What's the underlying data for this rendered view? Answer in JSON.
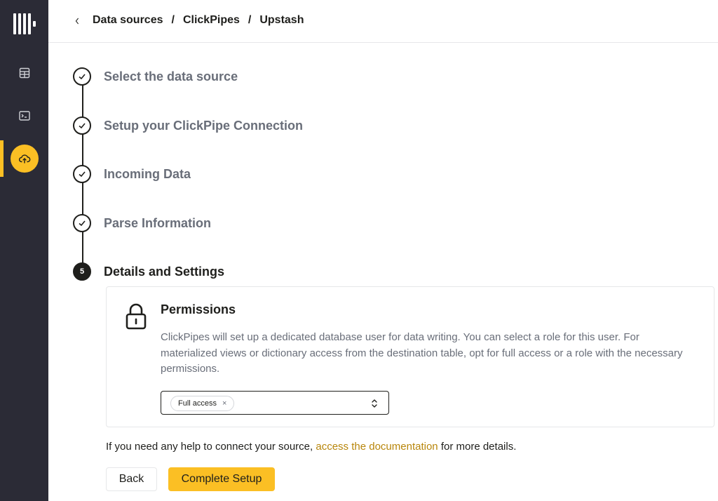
{
  "breadcrumb": {
    "items": [
      "Data sources",
      "ClickPipes",
      "Upstash"
    ],
    "separator": "/"
  },
  "sidebar": {
    "items": [
      {
        "icon": "table-icon"
      },
      {
        "icon": "terminal-icon"
      },
      {
        "icon": "cloud-upload-icon",
        "active": true
      }
    ]
  },
  "steps": [
    {
      "label": "Select the data source",
      "status": "complete"
    },
    {
      "label": "Setup your ClickPipe Connection",
      "status": "complete"
    },
    {
      "label": "Incoming Data",
      "status": "complete"
    },
    {
      "label": "Parse Information",
      "status": "complete"
    },
    {
      "number": "5",
      "label": "Details and Settings",
      "status": "current"
    }
  ],
  "permissions": {
    "title": "Permissions",
    "description": "ClickPipes will set up a dedicated database user for data writing. You can select a role for this user. For materialized views or dictionary access from the destination table, opt for full access or a role with the necessary permissions.",
    "selected_role": "Full access",
    "chip_remove": "×"
  },
  "help": {
    "prefix": "If you need any help to connect your source,",
    "link_text": "access the documentation",
    "suffix": "for more details."
  },
  "buttons": {
    "back": "Back",
    "complete": "Complete Setup"
  },
  "colors": {
    "sidebar_bg": "#2b2b36",
    "accent": "#fbbf24",
    "link": "#b8860b",
    "text_muted": "#696e79",
    "text_dark": "#1f1f1c"
  }
}
